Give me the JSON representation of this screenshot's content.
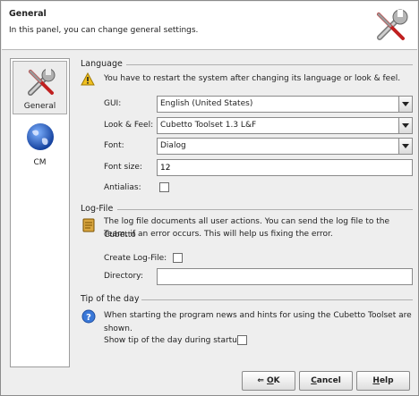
{
  "header": {
    "title": "General",
    "description": "In this panel, you can change general settings."
  },
  "sidebar": {
    "items": [
      {
        "label": "General",
        "icon": "tools-icon",
        "selected": true
      },
      {
        "label": "CM",
        "icon": "globe-icon",
        "selected": false
      }
    ]
  },
  "language": {
    "title": "Language",
    "info": "You have to restart the system after changing its language or look & feel.",
    "gui_label": "GUI:",
    "gui_value": "English (United States)",
    "lookfeel_label": "Look & Feel:",
    "lookfeel_value": "Cubetto Toolset 1.3 L&F",
    "font_label": "Font:",
    "font_value": "Dialog",
    "fontsize_label": "Font size:",
    "fontsize_value": "12",
    "antialias_label": "Antialias:",
    "antialias_checked": false
  },
  "logfile": {
    "title": "Log-File",
    "info_line1": "The log file documents all user actions. You can send the log file to the Cubetto",
    "info_line2": "Team, if an error occurs. This will help us fixing the error.",
    "create_label": "Create Log-File:",
    "create_checked": false,
    "directory_label": "Directory:",
    "directory_value": ""
  },
  "tip": {
    "title": "Tip of the day",
    "info": "When starting the program news and hints for using the Cubetto Toolset are shown.",
    "show_label": "Show tip of the day during startup:",
    "show_checked": false
  },
  "buttons": {
    "ok_prefix": "⇐ ",
    "ok_u": "O",
    "ok_rest": "K",
    "cancel_u": "C",
    "cancel_rest": "ancel",
    "help_u": "H",
    "help_rest": "elp"
  },
  "colors": {
    "accent_blue": "#2a5fb0",
    "warning_yellow": "#f0c020"
  }
}
